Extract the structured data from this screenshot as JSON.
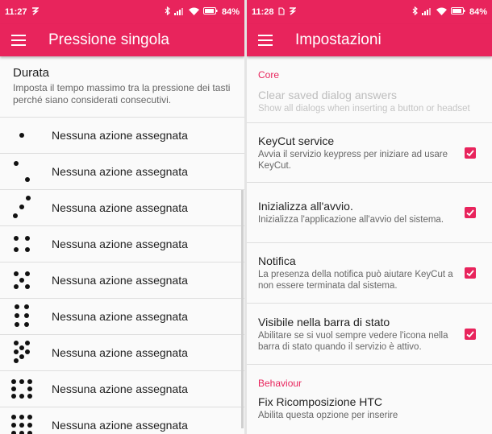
{
  "left": {
    "status": {
      "time": "11:27",
      "battery": "84%"
    },
    "title": "Pressione singola",
    "header": {
      "title": "Durata",
      "summary": "Imposta il tempo massimo tra la pressione dei tasti perché siano considerati consecutivi."
    },
    "rows": [
      {
        "icon": "dice-1-icon",
        "label": "Nessuna azione assegnata"
      },
      {
        "icon": "dice-2-icon",
        "label": "Nessuna azione assegnata"
      },
      {
        "icon": "dice-3-icon",
        "label": "Nessuna azione assegnata"
      },
      {
        "icon": "dice-4-icon",
        "label": "Nessuna azione assegnata"
      },
      {
        "icon": "dice-5-icon",
        "label": "Nessuna azione assegnata"
      },
      {
        "icon": "dice-6-icon",
        "label": "Nessuna azione assegnata"
      },
      {
        "icon": "dice-7-icon",
        "label": "Nessuna azione assegnata"
      },
      {
        "icon": "dice-8-icon",
        "label": "Nessuna azione assegnata"
      },
      {
        "icon": "dice-9-icon",
        "label": "Nessuna azione assegnata"
      }
    ]
  },
  "right": {
    "status": {
      "time": "11:28",
      "battery": "84%"
    },
    "title": "Impostazioni",
    "categories": {
      "core": "Core",
      "behaviour": "Behaviour"
    },
    "disabled_pref": {
      "title": "Clear saved dialog answers",
      "summary": "Show all dialogs when inserting a button or headset"
    },
    "prefs": [
      {
        "title": "KeyCut service",
        "summary": "Avvia il servizio keypress per iniziare ad usare KeyCut.",
        "checked": true
      },
      {
        "title": "Inizializza all'avvio.",
        "summary": "Inizializza l'applicazione all'avvio del sistema.",
        "checked": true
      },
      {
        "title": "Notifica",
        "summary": "La presenza della notifica può aiutare KeyCut a non essere terminata dal sistema.",
        "checked": true
      },
      {
        "title": "Visibile nella barra di stato",
        "summary": "Abilitare se si vuol sempre vedere l'icona nella barra di stato quando il servizio è attivo.",
        "checked": true
      }
    ],
    "partial_pref": {
      "title": "Fix Ricomposizione HTC",
      "summary": "Abilita questa opzione per inserire"
    }
  },
  "colors": {
    "accent": "#e8245c",
    "text": "#222222",
    "secondary": "#666666",
    "disabled": "#bdbdbd"
  }
}
